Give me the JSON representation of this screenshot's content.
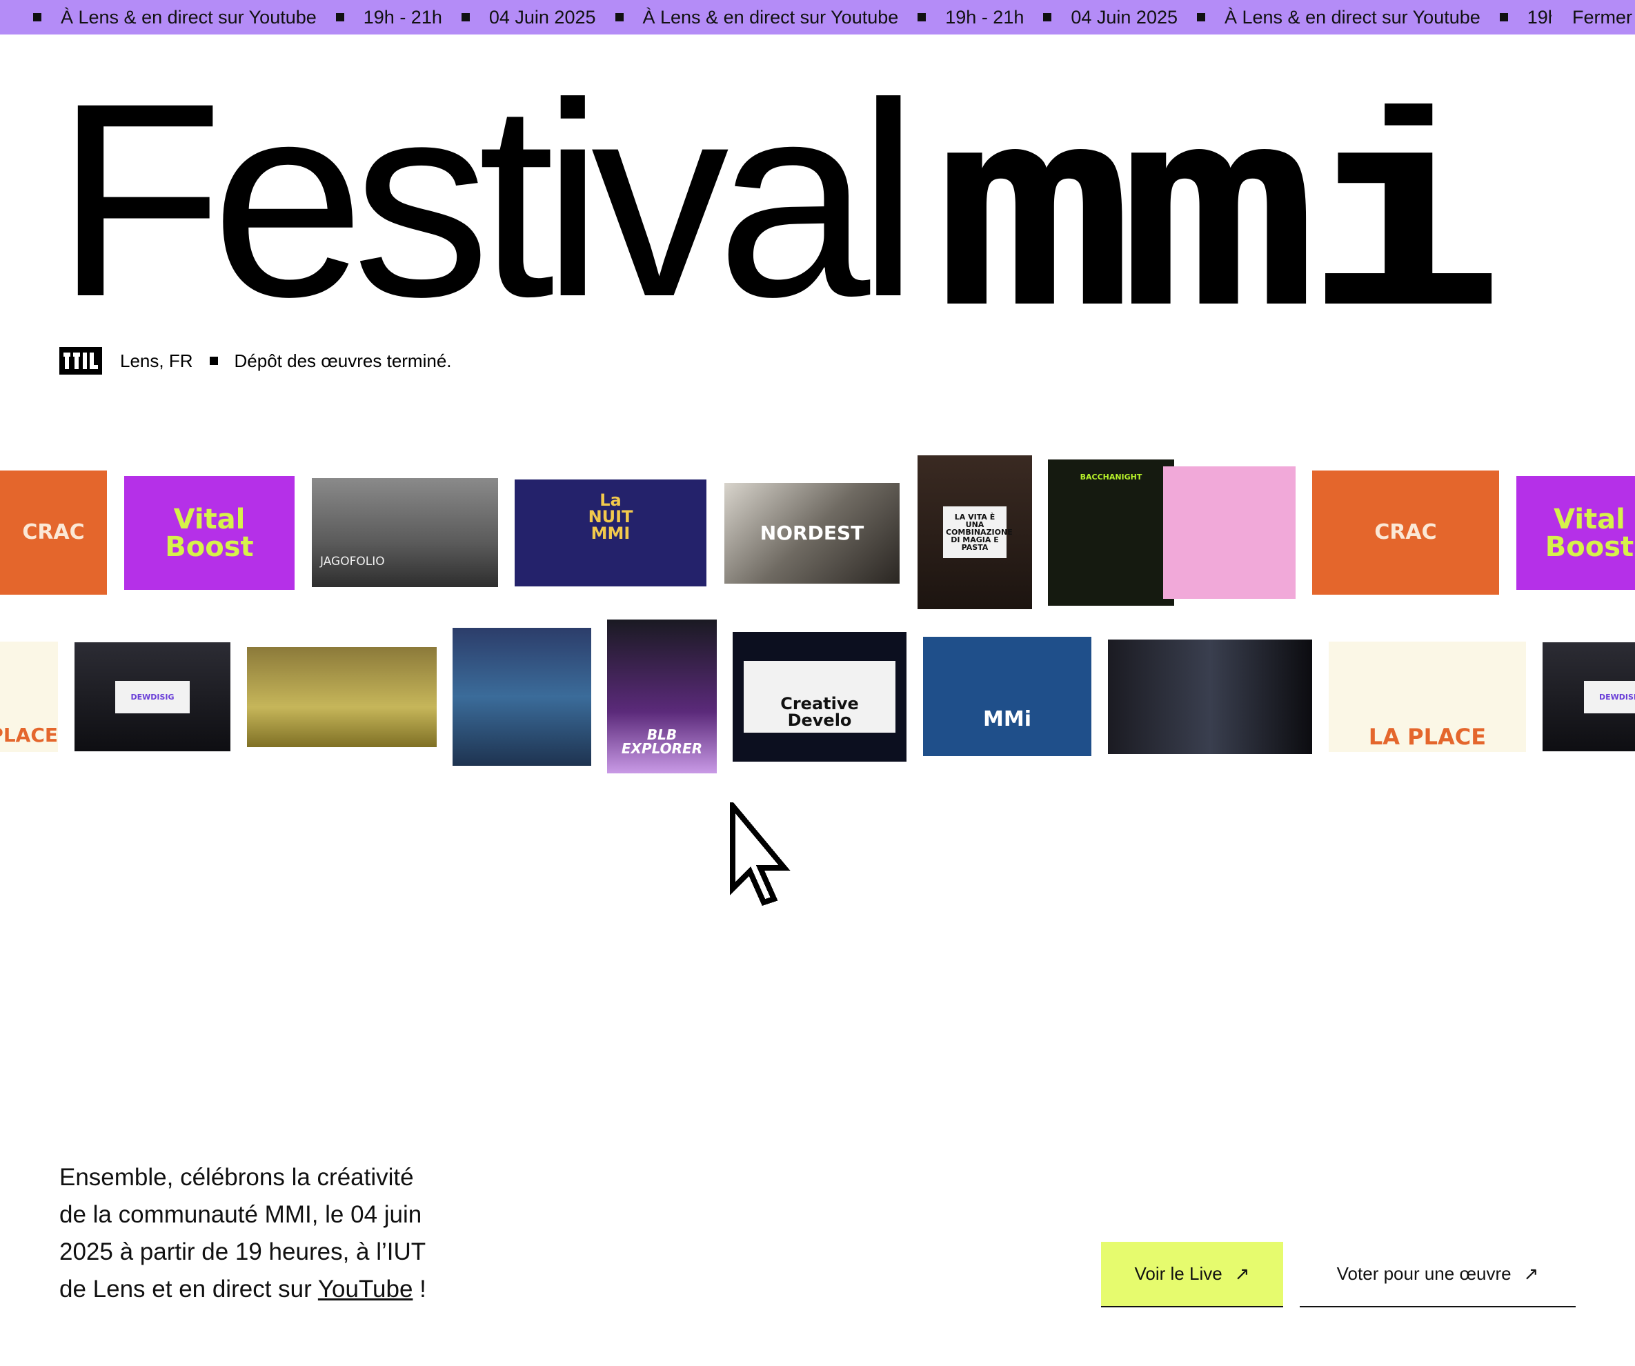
{
  "ticker": {
    "location": "À Lens & en direct sur Youtube",
    "time": "19h - 21h",
    "date": "04 Juin 2025",
    "close_label": "Fermer"
  },
  "hero": {
    "title_word": "Festival",
    "title_pixel": "mmi"
  },
  "meta": {
    "logo": "mmi-logo-icon",
    "location": "Lens, FR",
    "status": "Dépôt des œuvres terminé."
  },
  "gallery": {
    "row1": [
      {
        "label": "CRAC",
        "style": "c-orange"
      },
      {
        "label": "Vital Boost",
        "style": "c-purple"
      },
      {
        "label": "JAGOFOLIO",
        "style": "c-gray"
      },
      {
        "label": "La NUIT MMI",
        "style": "c-navy"
      },
      {
        "label": "NORDEST",
        "style": "c-photo"
      },
      {
        "label": "LA VITA È UNA COMBINAZIONE DI MAGIA E PASTA",
        "style": "c-bottle"
      },
      {
        "label": "BACCHANIGHT",
        "style": "c-lime"
      },
      {
        "label": "",
        "style": "c-pink"
      },
      {
        "label": "CRAC",
        "style": "c-orange"
      },
      {
        "label": "Vital Boost",
        "style": "c-purple"
      }
    ],
    "row2": [
      {
        "label": "LA PLACE",
        "style": "c-cream"
      },
      {
        "label": "DEWDISIG",
        "style": "c-dark"
      },
      {
        "label": "",
        "style": "c-field"
      },
      {
        "label": "",
        "style": "c-sponge"
      },
      {
        "label": "BLB EXPLORER",
        "style": "c-crowd"
      },
      {
        "label": "Creative Develo",
        "style": "c-black"
      },
      {
        "label": "MMi",
        "style": "c-blue"
      },
      {
        "label": "",
        "style": "c-room"
      },
      {
        "label": "LA PLACE",
        "style": "c-cream"
      },
      {
        "label": "DEWDISIG",
        "style": "c-dark"
      }
    ]
  },
  "intro": {
    "text_before": "Ensemble, célébrons la créativité de la communauté MMI, le 04 juin 2025 à partir de 19 heures, à l’IUT de Lens et en direct sur ",
    "link_label": "YouTube",
    "text_after": " !"
  },
  "actions": {
    "live_label": "Voir le Live",
    "vote_label": "Voter pour une œuvre",
    "arrow": "↗"
  },
  "colors": {
    "ticker_bg": "#b48cf7",
    "live_button": "#e6fb6e"
  }
}
